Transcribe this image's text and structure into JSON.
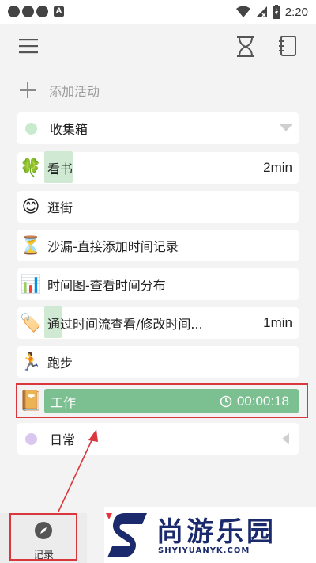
{
  "status_bar": {
    "time": "2:20",
    "notification_letter": "A"
  },
  "app_bar": {
    "left_icon": "menu-icon",
    "right_icons": [
      "hourglass-icon",
      "notebook-icon"
    ]
  },
  "add_activity": {
    "label": "添加活动"
  },
  "inbox": {
    "label": "收集箱",
    "dot_color": "#c7ebcc"
  },
  "activities": [
    {
      "icon": "clover-icon",
      "label": "看书",
      "value": "2min"
    },
    {
      "icon": "smile-icon",
      "label": "逛街",
      "value": ""
    },
    {
      "icon": "hourglass-icon",
      "label": "沙漏-直接添加时间记录",
      "value": ""
    },
    {
      "icon": "bar-chart-icon",
      "label": "时间图-查看时间分布",
      "value": ""
    },
    {
      "icon": "tag-icon",
      "label": "通过时间流查看/修改时间...",
      "value": "1min"
    },
    {
      "icon": "runner-icon",
      "label": "跑步",
      "value": ""
    }
  ],
  "running": {
    "label": "工作",
    "timer": "00:00:18",
    "accent": "#7cbf90"
  },
  "daily": {
    "label": "日常",
    "dot_color": "#d9c7ef"
  },
  "bottom_nav": {
    "label": "记录"
  },
  "watermark": {
    "text": "尚游乐园",
    "url_text": "SHYIYUANYK.COM"
  },
  "colors": {
    "annotation_red": "#d9363e",
    "highlight_green": "#cfe9d3"
  }
}
